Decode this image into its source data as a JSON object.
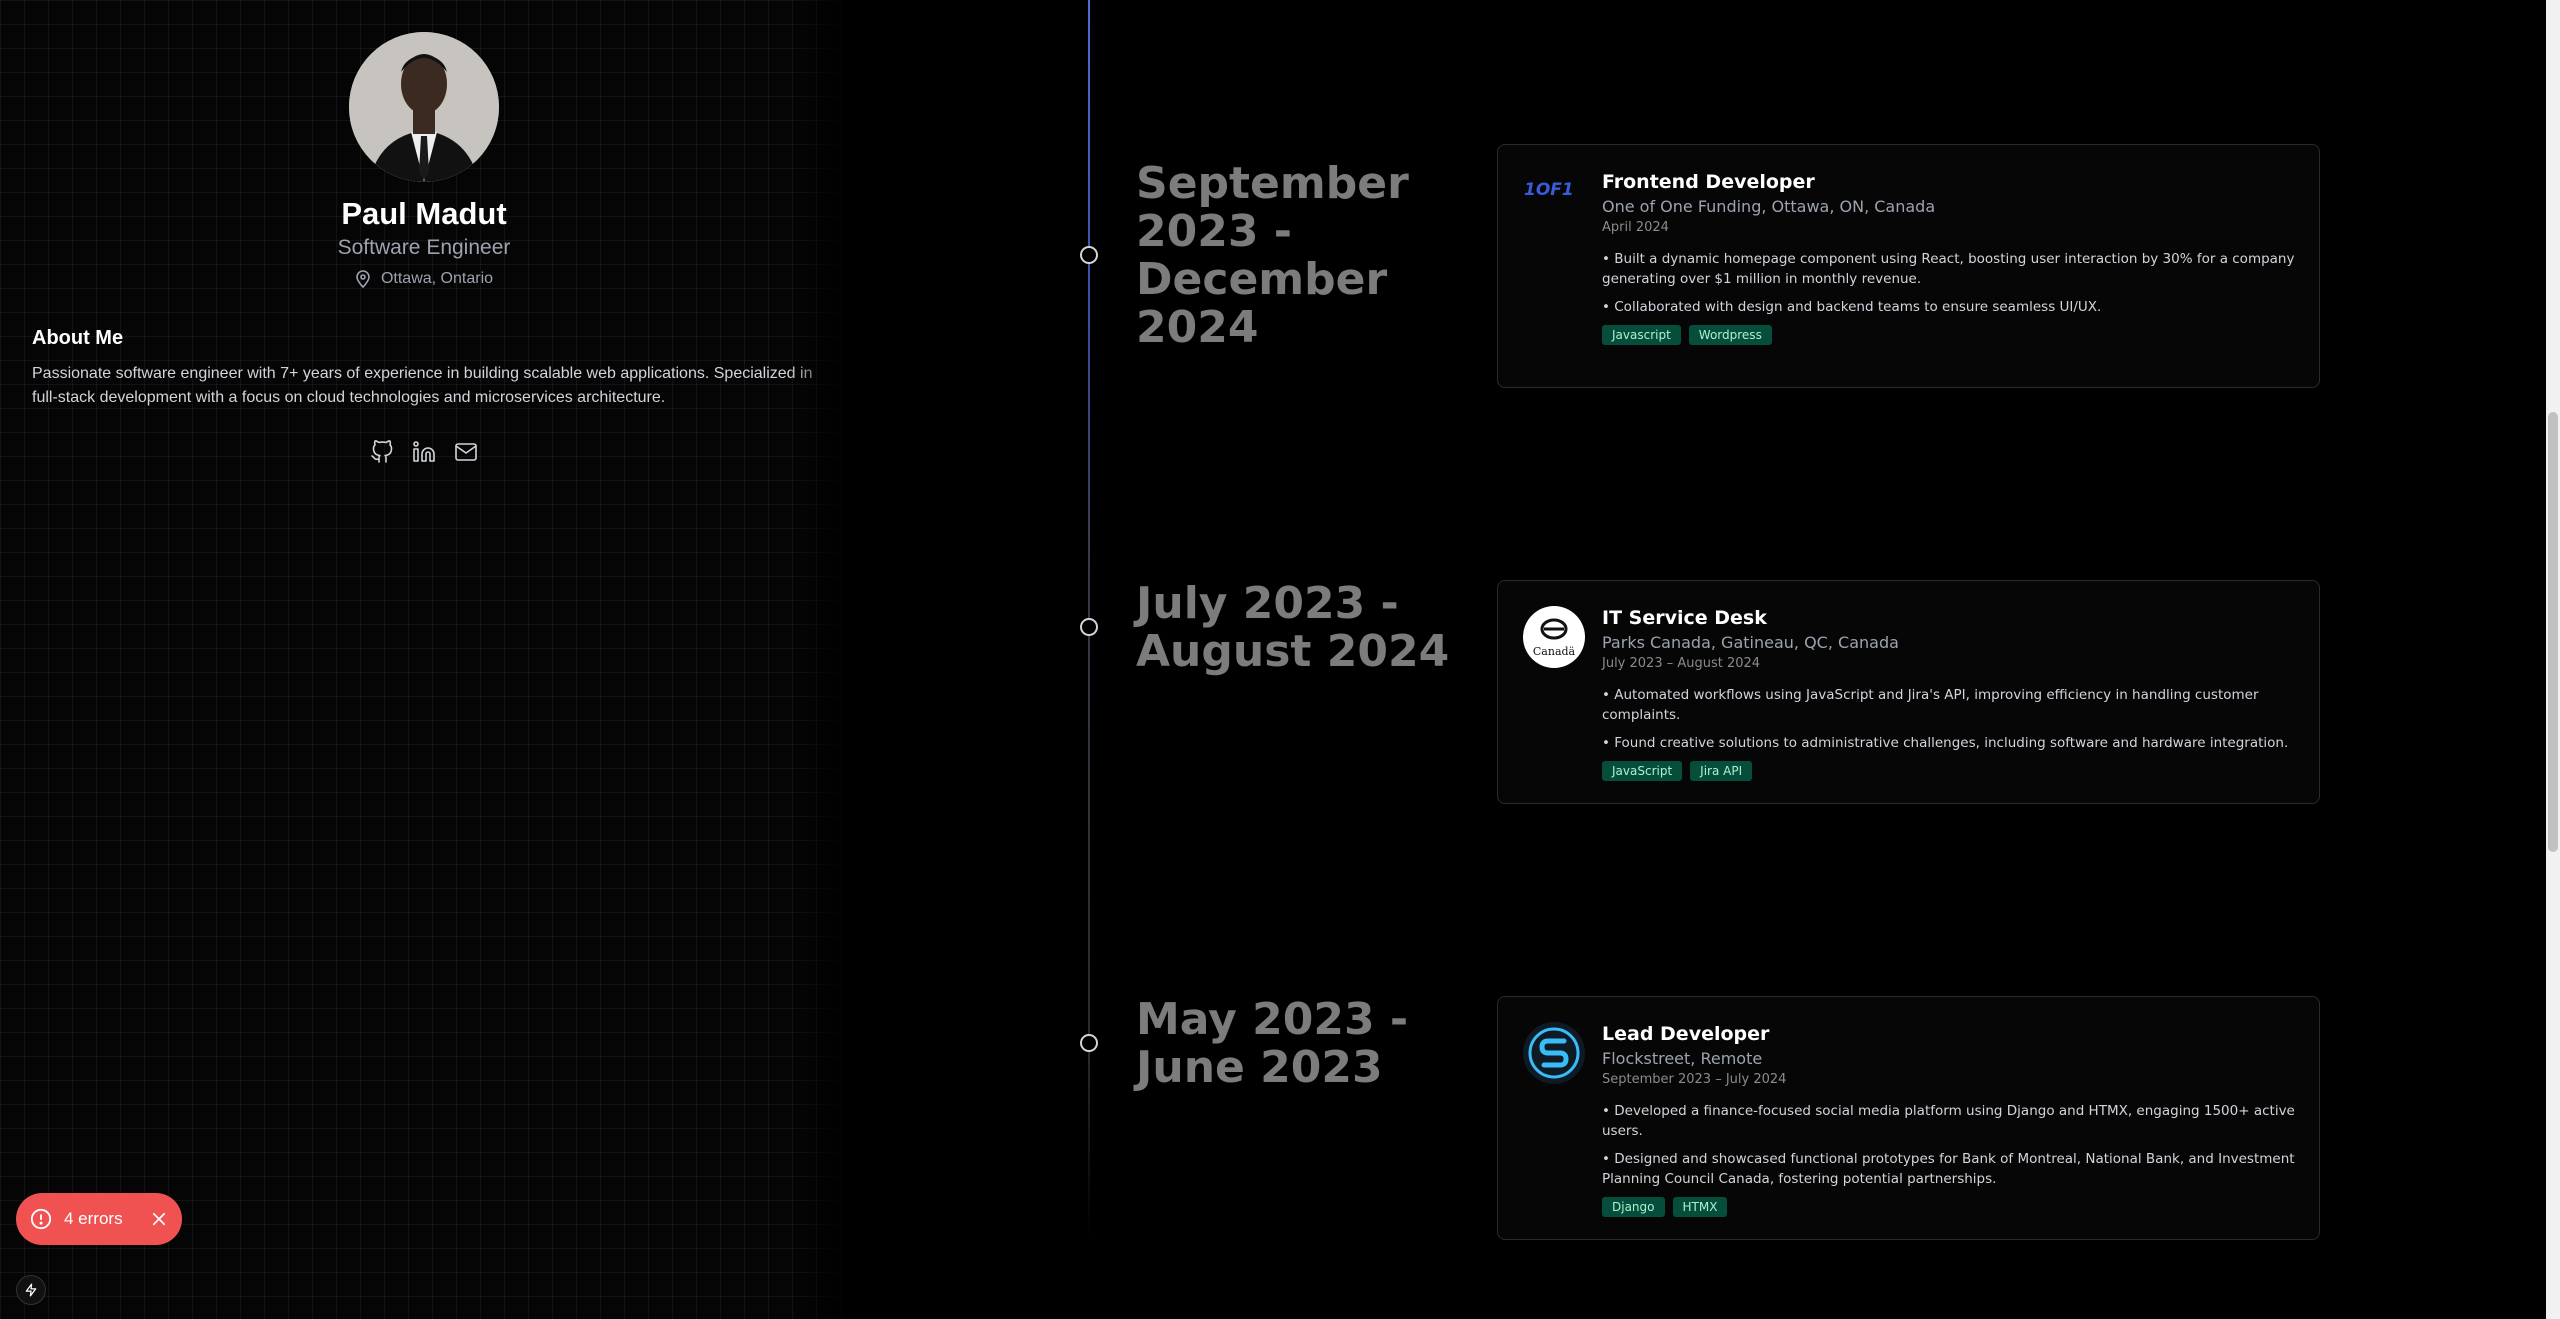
{
  "profile": {
    "name": "Paul Madut",
    "role": "Software Engineer",
    "location": "Ottawa, Ontario",
    "about_heading": "About Me",
    "about_text": "Passionate software engineer with 7+ years of experience in building scalable web applications. Specialized in full-stack development with a focus on cloud technologies and microservices architecture.",
    "socials": [
      {
        "icon": "github-icon"
      },
      {
        "icon": "linkedin-icon"
      },
      {
        "icon": "mail-icon"
      }
    ]
  },
  "experience": [
    {
      "date_line1": "September",
      "date_line2": "2023 -",
      "date_line3": "December",
      "date_line4": "2024",
      "logo": "1of1-logo",
      "logo_text": "1OF1",
      "title": "Frontend Developer",
      "company": "One of One Funding, Ottawa, ON, Canada",
      "period": "April 2024",
      "bullets": [
        "• Built a dynamic homepage component using React, boosting user interaction by 30% for a company generating over $1 million in monthly revenue.",
        "• Collaborated with design and backend teams to ensure seamless UI/UX."
      ],
      "tags": [
        "Javascript",
        "Wordpress"
      ]
    },
    {
      "date_line1": "July 2023 -",
      "date_line2": "August 2024",
      "logo": "parks-canada-logo",
      "logo_text": "Canadä",
      "title": "IT Service Desk",
      "company": "Parks Canada, Gatineau, QC, Canada",
      "period": "July 2023 – August 2024",
      "bullets": [
        "• Automated workflows using JavaScript and Jira's API, improving efficiency in handling customer complaints.",
        "• Found creative solutions to administrative challenges, including software and hardware integration."
      ],
      "tags": [
        "JavaScript",
        "Jira API"
      ]
    },
    {
      "date_line1": "May 2023 -",
      "date_line2": "June 2023",
      "logo": "flockstreet-logo",
      "title": "Lead Developer",
      "company": "Flockstreet, Remote",
      "period": "September 2023 – July 2024",
      "bullets": [
        "• Developed a finance-focused social media platform using Django and HTMX, engaging 1500+ active users.",
        "• Designed and showcased functional prototypes for Bank of Montreal, National Bank, and Investment Planning Council Canada, fostering potential partnerships."
      ],
      "tags": [
        "Django",
        "HTMX"
      ]
    }
  ],
  "toast": {
    "label": "4 errors",
    "icon": "alert-circle-icon"
  },
  "colors": {
    "accent_blue": "#4f6cd6",
    "tag_bg": "#064e3b",
    "tag_text": "#a7f3d0",
    "toast": "#f05252"
  }
}
